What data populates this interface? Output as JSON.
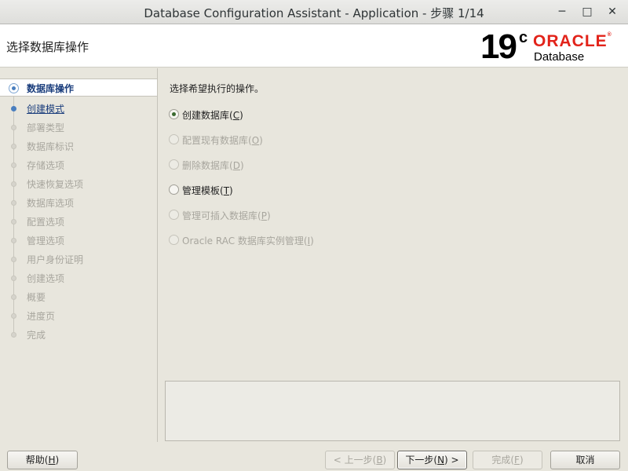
{
  "window": {
    "title": "Database Configuration Assistant - Application - 步骤 1/14",
    "controls": {
      "minimize": "─",
      "maximize": "□",
      "close": "✕"
    }
  },
  "header": {
    "title": "选择数据库操作",
    "logo": {
      "version": "19",
      "version_sup": "c",
      "brand": "ORACLE",
      "product": "Database"
    }
  },
  "steps": [
    {
      "label": "数据库操作",
      "state": "active"
    },
    {
      "label": "创建模式",
      "state": "next"
    },
    {
      "label": "部署类型",
      "state": "disabled"
    },
    {
      "label": "数据库标识",
      "state": "disabled"
    },
    {
      "label": "存储选项",
      "state": "disabled"
    },
    {
      "label": "快速恢复选项",
      "state": "disabled"
    },
    {
      "label": "数据库选项",
      "state": "disabled"
    },
    {
      "label": "配置选项",
      "state": "disabled"
    },
    {
      "label": "管理选项",
      "state": "disabled"
    },
    {
      "label": "用户身份证明",
      "state": "disabled"
    },
    {
      "label": "创建选项",
      "state": "disabled"
    },
    {
      "label": "概要",
      "state": "disabled"
    },
    {
      "label": "进度页",
      "state": "disabled"
    },
    {
      "label": "完成",
      "state": "disabled"
    }
  ],
  "main": {
    "prompt": "选择希望执行的操作。",
    "options": [
      {
        "label": "创建数据库(",
        "mnemonic": "C",
        "suffix": ")",
        "checked": true,
        "enabled": true
      },
      {
        "label": "配置现有数据库(",
        "mnemonic": "O",
        "suffix": ")",
        "checked": false,
        "enabled": false
      },
      {
        "label": "删除数据库(",
        "mnemonic": "D",
        "suffix": ")",
        "checked": false,
        "enabled": false
      },
      {
        "label": "管理模板(",
        "mnemonic": "T",
        "suffix": ")",
        "checked": false,
        "enabled": true
      },
      {
        "label": "管理可插入数据库(",
        "mnemonic": "P",
        "suffix": ")",
        "checked": false,
        "enabled": false
      },
      {
        "label": "Oracle RAC 数据库实例管理(",
        "mnemonic": "I",
        "suffix": ")",
        "checked": false,
        "enabled": false
      }
    ],
    "message": ""
  },
  "buttons": {
    "help": {
      "label": "帮助(",
      "mnemonic": "H",
      "suffix": ")"
    },
    "back": {
      "label": "< 上一步(",
      "mnemonic": "B",
      "suffix": ")"
    },
    "next": {
      "label": "下一步(",
      "mnemonic": "N",
      "suffix": ") >"
    },
    "finish": {
      "label": "完成(",
      "mnemonic": "F",
      "suffix": ")"
    },
    "cancel": {
      "label": "取消"
    }
  }
}
